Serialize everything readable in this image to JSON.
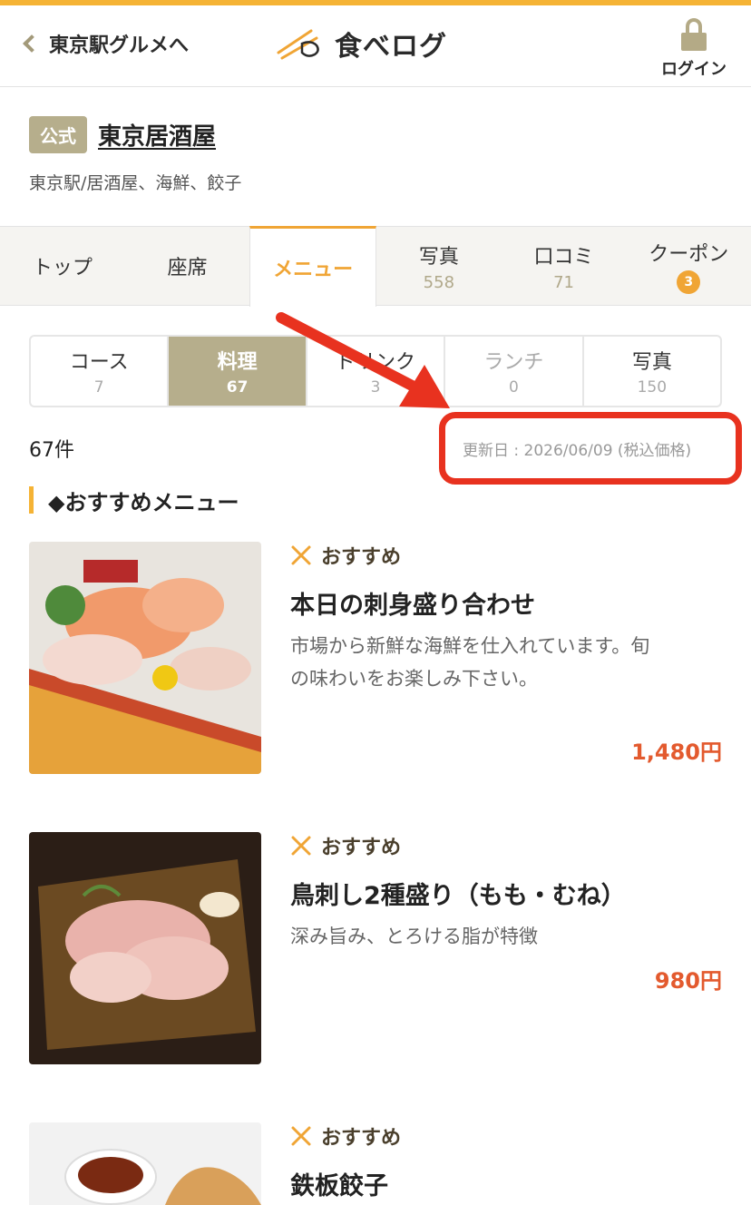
{
  "header": {
    "back_label": "東京駅グルメへ",
    "logo_text": "食べログ",
    "login_label": "ログイン"
  },
  "shop": {
    "official_badge": "公式",
    "name": "東京居酒屋",
    "category": "東京駅/居酒屋、海鮮、餃子"
  },
  "tabs": [
    {
      "label": "トップ",
      "count": ""
    },
    {
      "label": "座席",
      "count": ""
    },
    {
      "label": "メニュー",
      "count": ""
    },
    {
      "label": "写真",
      "count": "558"
    },
    {
      "label": "口コミ",
      "count": "71"
    },
    {
      "label": "クーポン",
      "count": "3"
    }
  ],
  "subtabs": [
    {
      "label": "コース",
      "count": "7"
    },
    {
      "label": "料理",
      "count": "67"
    },
    {
      "label": "ドリンク",
      "count": "3"
    },
    {
      "label": "ランチ",
      "count": "0"
    },
    {
      "label": "写真",
      "count": "150"
    }
  ],
  "list": {
    "count_label": "67件",
    "updated_label": "更新日 : 2026/06/09 (税込価格)",
    "section_title": "◆おすすめメニュー"
  },
  "menu_items": [
    {
      "recommend_label": "おすすめ",
      "name": "本日の刺身盛り合わせ",
      "description_line1": "市場から新鮮な海鮮を仕入れています。旬",
      "description_line2": "の味わいをお楽しみ下さい。",
      "price": "1,480円"
    },
    {
      "recommend_label": "おすすめ",
      "name": "鳥刺し2種盛り（もも・むね）",
      "description_line1": "深み旨み、とろける脂が特徴",
      "description_line2": "",
      "price": "980円"
    },
    {
      "recommend_label": "おすすめ",
      "name": "鉄板餃子",
      "description_line1": "",
      "description_line2": "",
      "price": ""
    }
  ],
  "colors": {
    "accent": "#f5b335",
    "active_tab": "#f0a535",
    "official_badge": "#b6ae8c",
    "price": "#e35a2e",
    "annotation": "#e8321f"
  },
  "icons": [
    "chevron-left-icon",
    "chopsticks-logo-icon",
    "lock-icon",
    "fork-knife-icon"
  ]
}
